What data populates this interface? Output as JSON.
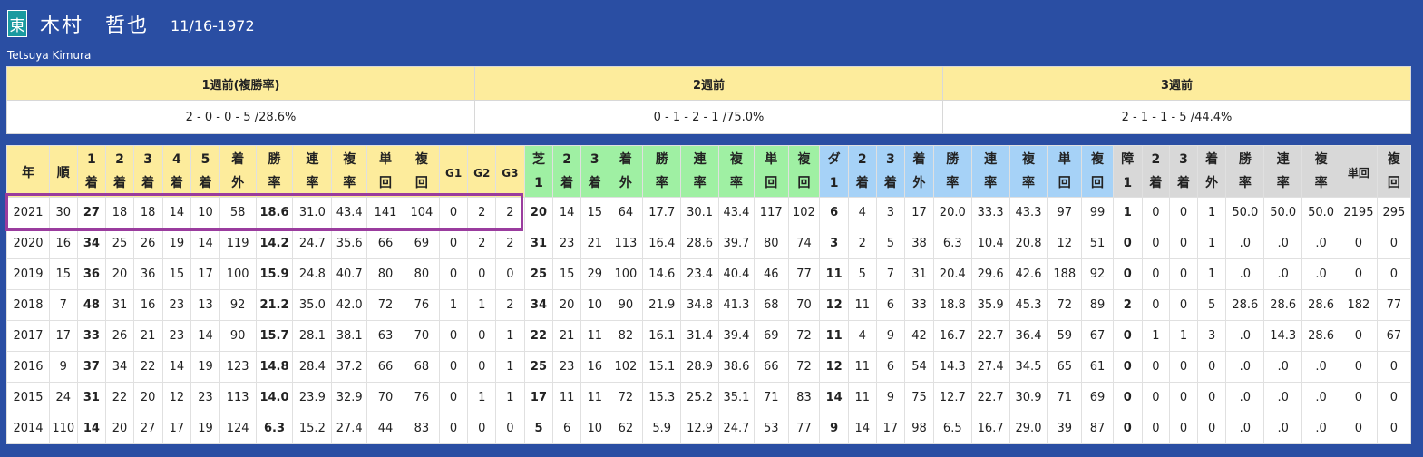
{
  "jockey": {
    "affiliation_badge": "東",
    "name": "木村　哲也",
    "dob": "11/16-1972",
    "romanized": "Tetsuya Kimura"
  },
  "recent": {
    "headers": [
      "1週前(複勝率)",
      "2週前",
      "3週前"
    ],
    "values": [
      "2 - 0 - 0 - 5 /28.6%",
      "0 - 1 - 2 - 1 /75.0%",
      "2 - 1 - 1 - 5 /44.4%"
    ]
  },
  "stats": {
    "headers": [
      [
        "年"
      ],
      [
        "順"
      ],
      [
        "1",
        "着"
      ],
      [
        "2",
        "着"
      ],
      [
        "3",
        "着"
      ],
      [
        "4",
        "着"
      ],
      [
        "5",
        "着"
      ],
      [
        "着",
        "外"
      ],
      [
        "勝",
        "率"
      ],
      [
        "連",
        "率"
      ],
      [
        "複",
        "率"
      ],
      [
        "単",
        "回"
      ],
      [
        "複",
        "回"
      ],
      [
        "G1"
      ],
      [
        "G2"
      ],
      [
        "G3"
      ],
      [
        "芝",
        "1"
      ],
      [
        "2",
        "着"
      ],
      [
        "3",
        "着"
      ],
      [
        "着",
        "外"
      ],
      [
        "勝",
        "率"
      ],
      [
        "連",
        "率"
      ],
      [
        "複",
        "率"
      ],
      [
        "単",
        "回"
      ],
      [
        "複",
        "回"
      ],
      [
        "ダ",
        "1"
      ],
      [
        "2",
        "着"
      ],
      [
        "3",
        "着"
      ],
      [
        "着",
        "外"
      ],
      [
        "勝",
        "率"
      ],
      [
        "連",
        "率"
      ],
      [
        "複",
        "率"
      ],
      [
        "単",
        "回"
      ],
      [
        "複",
        "回"
      ],
      [
        "障",
        "1"
      ],
      [
        "2",
        "着"
      ],
      [
        "3",
        "着"
      ],
      [
        "着",
        "外"
      ],
      [
        "勝",
        "率"
      ],
      [
        "連",
        "率"
      ],
      [
        "複",
        "率"
      ],
      [
        "単回"
      ],
      [
        "複",
        "回"
      ]
    ],
    "rows": [
      [
        "2021",
        "30",
        "27",
        "18",
        "18",
        "14",
        "10",
        "58",
        "18.6",
        "31.0",
        "43.4",
        "141",
        "104",
        "0",
        "2",
        "2",
        "20",
        "14",
        "15",
        "64",
        "17.7",
        "30.1",
        "43.4",
        "117",
        "102",
        "6",
        "4",
        "3",
        "17",
        "20.0",
        "33.3",
        "43.3",
        "97",
        "99",
        "1",
        "0",
        "0",
        "1",
        "50.0",
        "50.0",
        "50.0",
        "2195",
        "295"
      ],
      [
        "2020",
        "16",
        "34",
        "25",
        "26",
        "19",
        "14",
        "119",
        "14.2",
        "24.7",
        "35.6",
        "66",
        "69",
        "0",
        "2",
        "2",
        "31",
        "23",
        "21",
        "113",
        "16.4",
        "28.6",
        "39.7",
        "80",
        "74",
        "3",
        "2",
        "5",
        "38",
        "6.3",
        "10.4",
        "20.8",
        "12",
        "51",
        "0",
        "0",
        "0",
        "1",
        ".0",
        ".0",
        ".0",
        "0",
        "0"
      ],
      [
        "2019",
        "15",
        "36",
        "20",
        "36",
        "15",
        "17",
        "100",
        "15.9",
        "24.8",
        "40.7",
        "80",
        "80",
        "0",
        "0",
        "0",
        "25",
        "15",
        "29",
        "100",
        "14.6",
        "23.4",
        "40.4",
        "46",
        "77",
        "11",
        "5",
        "7",
        "31",
        "20.4",
        "29.6",
        "42.6",
        "188",
        "92",
        "0",
        "0",
        "0",
        "1",
        ".0",
        ".0",
        ".0",
        "0",
        "0"
      ],
      [
        "2018",
        "7",
        "48",
        "31",
        "16",
        "23",
        "13",
        "92",
        "21.2",
        "35.0",
        "42.0",
        "72",
        "76",
        "1",
        "1",
        "2",
        "34",
        "20",
        "10",
        "90",
        "21.9",
        "34.8",
        "41.3",
        "68",
        "70",
        "12",
        "11",
        "6",
        "33",
        "18.8",
        "35.9",
        "45.3",
        "72",
        "89",
        "2",
        "0",
        "0",
        "5",
        "28.6",
        "28.6",
        "28.6",
        "182",
        "77"
      ],
      [
        "2017",
        "17",
        "33",
        "26",
        "21",
        "23",
        "14",
        "90",
        "15.7",
        "28.1",
        "38.1",
        "63",
        "70",
        "0",
        "0",
        "1",
        "22",
        "21",
        "11",
        "82",
        "16.1",
        "31.4",
        "39.4",
        "69",
        "72",
        "11",
        "4",
        "9",
        "42",
        "16.7",
        "22.7",
        "36.4",
        "59",
        "67",
        "0",
        "1",
        "1",
        "3",
        ".0",
        "14.3",
        "28.6",
        "0",
        "67"
      ],
      [
        "2016",
        "9",
        "37",
        "34",
        "22",
        "14",
        "19",
        "123",
        "14.8",
        "28.4",
        "37.2",
        "66",
        "68",
        "0",
        "0",
        "1",
        "25",
        "23",
        "16",
        "102",
        "15.1",
        "28.9",
        "38.6",
        "66",
        "72",
        "12",
        "11",
        "6",
        "54",
        "14.3",
        "27.4",
        "34.5",
        "65",
        "61",
        "0",
        "0",
        "0",
        "0",
        ".0",
        ".0",
        ".0",
        "0",
        "0"
      ],
      [
        "2015",
        "24",
        "31",
        "22",
        "20",
        "12",
        "23",
        "113",
        "14.0",
        "23.9",
        "32.9",
        "70",
        "76",
        "0",
        "1",
        "1",
        "17",
        "11",
        "11",
        "72",
        "15.3",
        "25.2",
        "35.1",
        "71",
        "83",
        "14",
        "11",
        "9",
        "75",
        "12.7",
        "22.7",
        "30.9",
        "71",
        "69",
        "0",
        "0",
        "0",
        "0",
        ".0",
        ".0",
        ".0",
        "0",
        "0"
      ],
      [
        "2014",
        "110",
        "14",
        "20",
        "27",
        "17",
        "19",
        "124",
        "6.3",
        "15.2",
        "27.4",
        "44",
        "83",
        "0",
        "0",
        "0",
        "5",
        "6",
        "10",
        "62",
        "5.9",
        "12.9",
        "24.7",
        "53",
        "77",
        "9",
        "14",
        "17",
        "98",
        "6.5",
        "16.7",
        "29.0",
        "39",
        "87",
        "0",
        "0",
        "0",
        "0",
        ".0",
        ".0",
        ".0",
        "0",
        "0"
      ]
    ]
  },
  "colors": {
    "background": "#2a4ea3",
    "general_header": "#fdec9c",
    "turf_header": "#9ff0a3",
    "dirt_header": "#a6d2f7",
    "jump_header": "#d8d8d8",
    "highlight": "#9a3c9e"
  }
}
